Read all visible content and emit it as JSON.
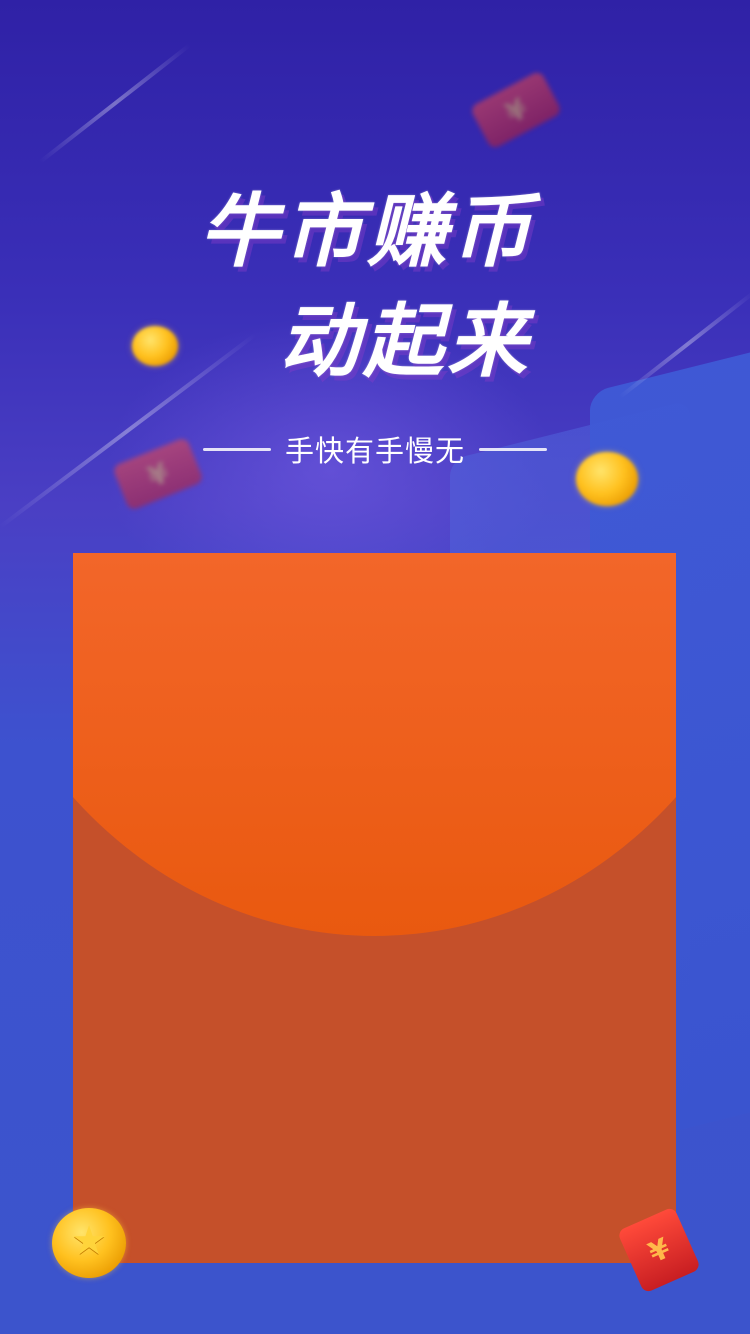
{
  "title": {
    "line1": "牛市赚币",
    "line2": "动起来"
  },
  "subtitle": "手快有手慢无",
  "currency_glyph": "¥",
  "icons": {
    "coin": "gold-coin-icon",
    "star_coin": "star-coin-icon",
    "red_envelope": "red-envelope-icon"
  },
  "colors": {
    "background_top": "#2f21a6",
    "background_bottom": "#3c54cc",
    "envelope_body": "#c5502a",
    "envelope_flap": "#f66a32",
    "coin_gold": "#ffc11f"
  }
}
